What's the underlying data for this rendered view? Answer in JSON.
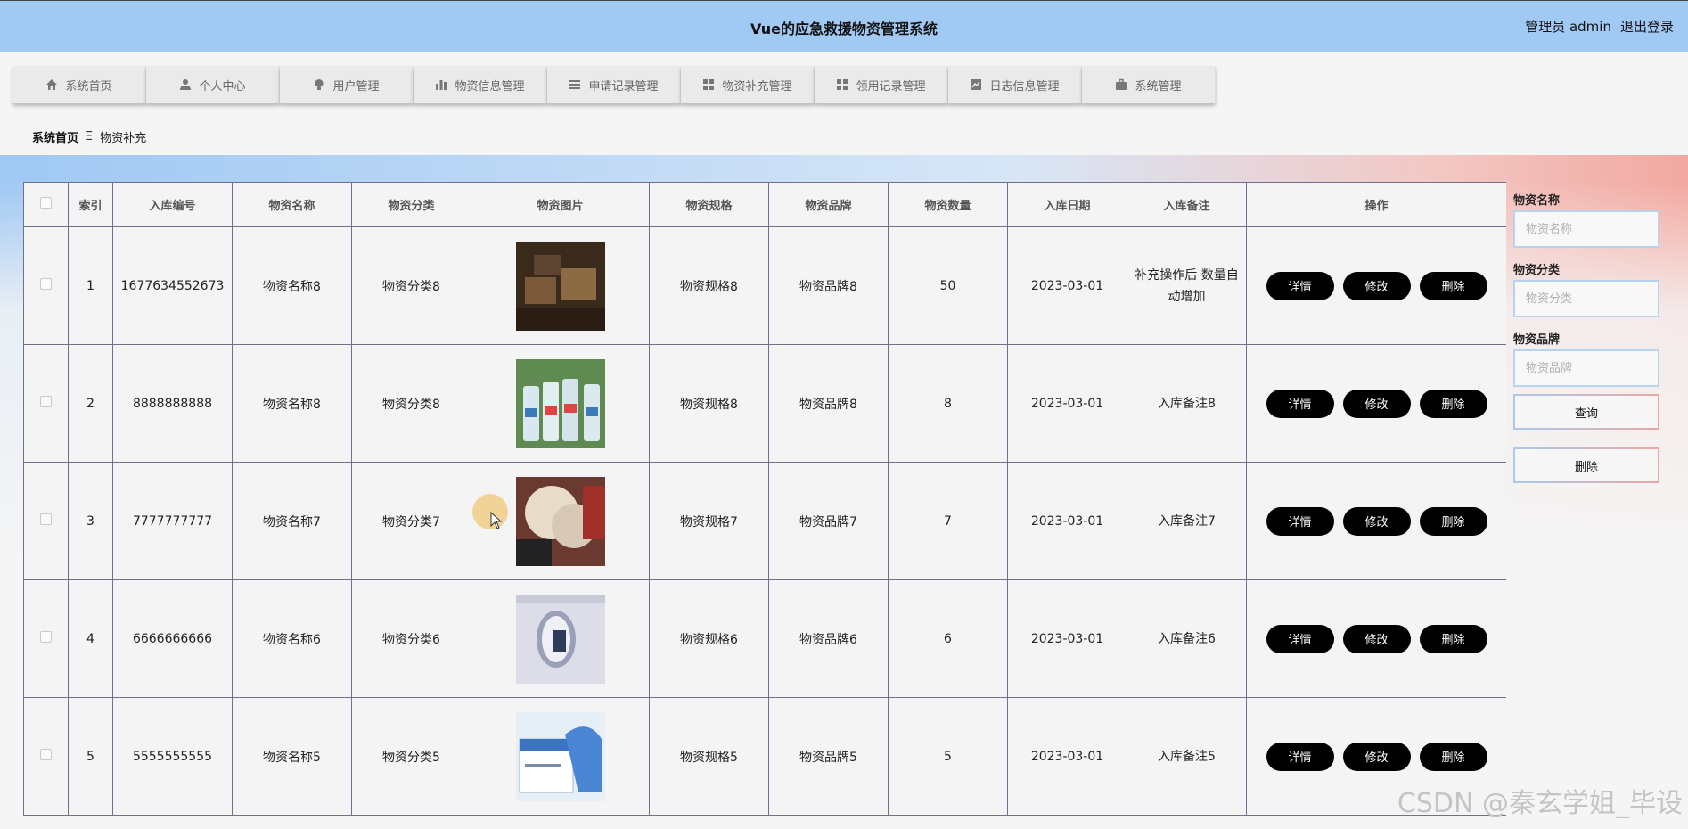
{
  "header": {
    "title": "Vue的应急救援物资管理系统",
    "user_label": "管理员 admin",
    "logout_label": "退出登录"
  },
  "nav": {
    "items": [
      {
        "label": "系统首页",
        "icon": "home-icon"
      },
      {
        "label": "个人中心",
        "icon": "user-icon"
      },
      {
        "label": "用户管理",
        "icon": "bulb-icon"
      },
      {
        "label": "物资信息管理",
        "icon": "bar-chart-icon"
      },
      {
        "label": "申请记录管理",
        "icon": "list-icon"
      },
      {
        "label": "物资补充管理",
        "icon": "grid-icon"
      },
      {
        "label": "领用记录管理",
        "icon": "grid-icon"
      },
      {
        "label": "日志信息管理",
        "icon": "line-chart-icon"
      },
      {
        "label": "系统管理",
        "icon": "briefcase-icon"
      }
    ]
  },
  "breadcrumb": {
    "home": "系统首页",
    "separator": "Ξ",
    "current": "物资补充"
  },
  "table": {
    "headers": [
      "索引",
      "入库编号",
      "物资名称",
      "物资分类",
      "物资图片",
      "物资规格",
      "物资品牌",
      "物资数量",
      "入库日期",
      "入库备注",
      "操作"
    ],
    "rows": [
      {
        "index": "1",
        "code": "1677634552673",
        "name": "物资名称8",
        "category": "物资分类8",
        "image": "boxes-photo",
        "spec": "物资规格8",
        "brand": "物资品牌8",
        "qty": "50",
        "date": "2023-03-01",
        "note": "补充操作后 数量自动增加"
      },
      {
        "index": "2",
        "code": "8888888888",
        "name": "物资名称8",
        "category": "物资分类8",
        "image": "bottles-photo",
        "spec": "物资规格8",
        "brand": "物资品牌8",
        "qty": "8",
        "date": "2023-03-01",
        "note": "入库备注8"
      },
      {
        "index": "3",
        "code": "7777777777",
        "name": "物资名称7",
        "category": "物资分类7",
        "image": "gloves-photo",
        "spec": "物资规格7",
        "brand": "物资品牌7",
        "qty": "7",
        "date": "2023-03-01",
        "note": "入库备注7"
      },
      {
        "index": "4",
        "code": "6666666666",
        "name": "物资名称6",
        "category": "物资分类6",
        "image": "lab-photo",
        "spec": "物资规格6",
        "brand": "物资品牌6",
        "qty": "6",
        "date": "2023-03-01",
        "note": "入库备注6"
      },
      {
        "index": "5",
        "code": "5555555555",
        "name": "物资名称5",
        "category": "物资分类5",
        "image": "glove-box-photo",
        "spec": "物资规格5",
        "brand": "物资品牌5",
        "qty": "5",
        "date": "2023-03-01",
        "note": "入库备注5"
      }
    ],
    "actions": {
      "detail": "详情",
      "edit": "修改",
      "delete": "删除"
    }
  },
  "filters": {
    "name_label": "物资名称",
    "name_placeholder": "物资名称",
    "category_label": "物资分类",
    "category_placeholder": "物资分类",
    "brand_label": "物资品牌",
    "brand_placeholder": "物资品牌",
    "search_button": "查询",
    "delete_button": "删除"
  },
  "watermark": "CSDN @秦玄学姐_毕设",
  "colors": {
    "header_bg": "#a0c9f4",
    "button_bg": "#000000",
    "border": "#6f6f90"
  }
}
